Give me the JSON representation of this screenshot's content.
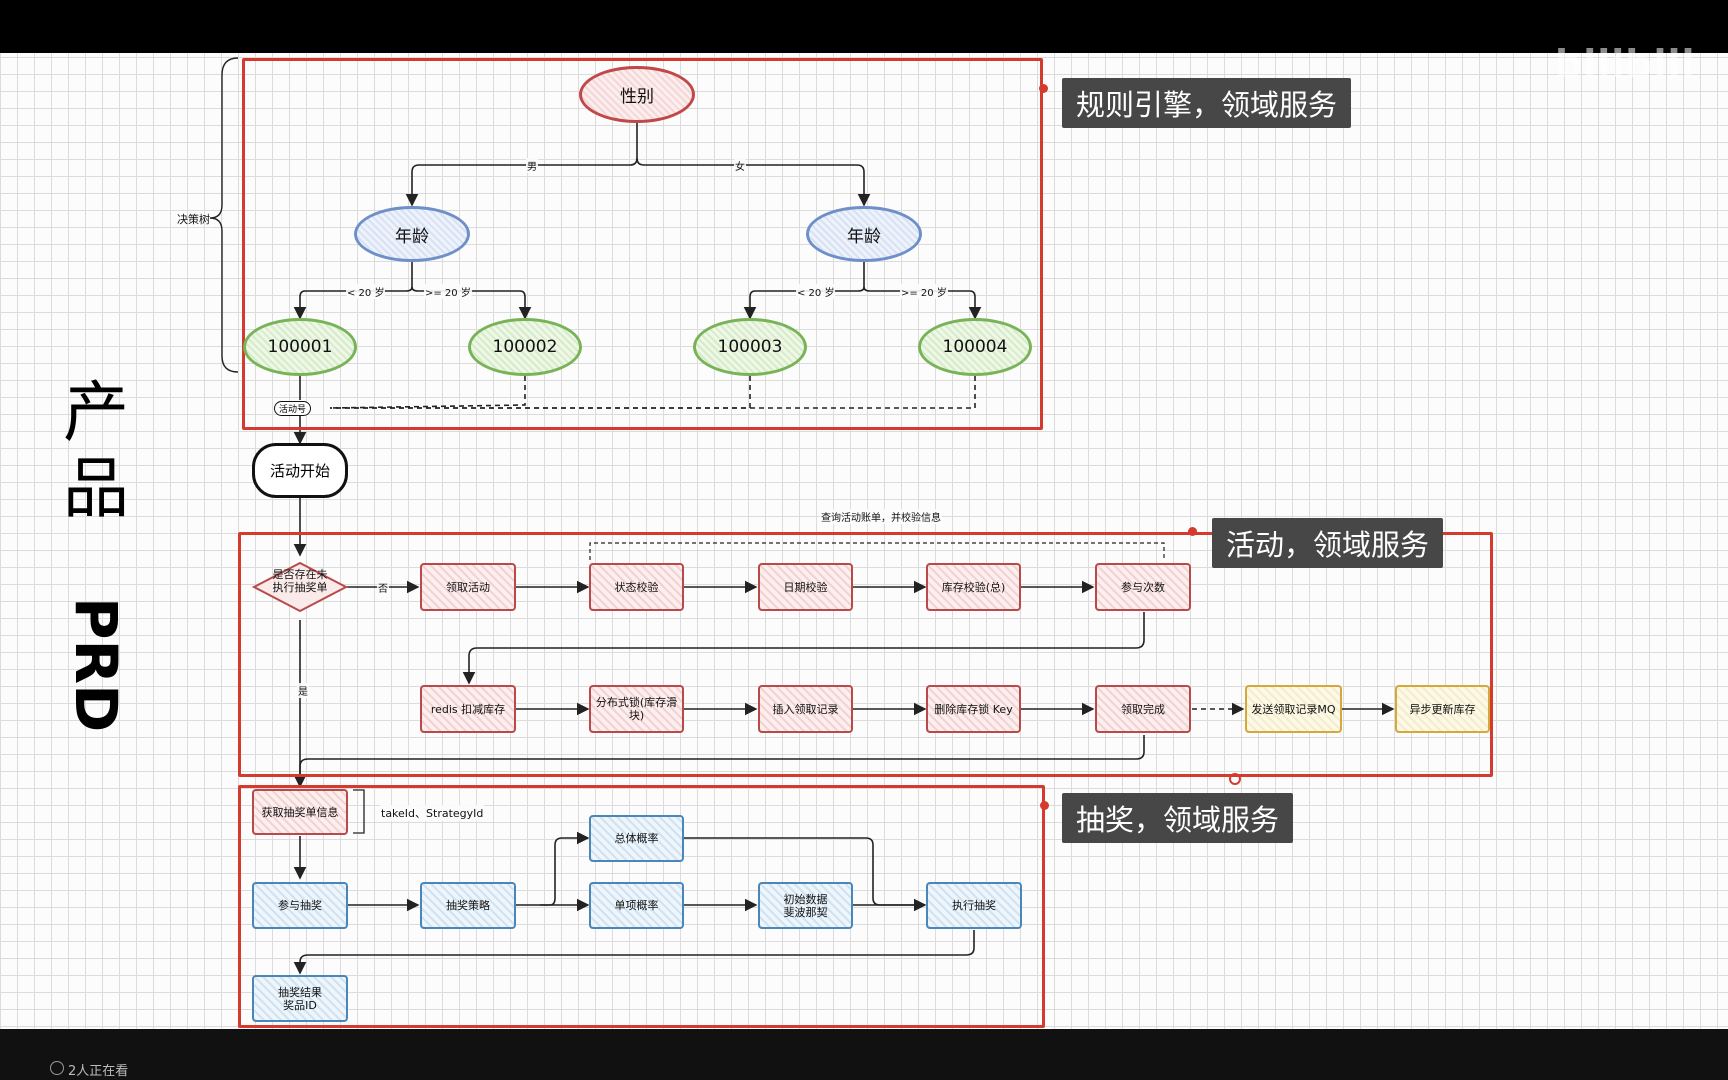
{
  "watermark": "bilibili",
  "viewer_text": "2人正在看",
  "side_title": {
    "chars": [
      "产",
      "品"
    ],
    "prd": "PRD"
  },
  "decision_tree_label": "决策树",
  "sections": {
    "rule_engine": "规则引擎，领域服务",
    "activity": "活动，领域服务",
    "lottery": "抽奖，领域服务"
  },
  "tree": {
    "root": "性别",
    "branch_male": "男",
    "branch_female": "女",
    "age_left": "年龄",
    "age_right": "年龄",
    "lt20_left": "< 20 岁",
    "ge20_left": ">= 20 岁",
    "lt20_right": "< 20 岁",
    "ge20_right": ">= 20 岁",
    "leaves": [
      "100001",
      "100002",
      "100003",
      "100004"
    ],
    "activity_no": "活动号"
  },
  "activity_flow": {
    "start": "活动开始",
    "decision": "是否存在未执行抽奖单",
    "no": "否",
    "yes": "是",
    "query_label": "查询活动账单，并校验信息",
    "row1": [
      "领取活动",
      "状态校验",
      "日期校验",
      "库存校验(总)",
      "参与次数"
    ],
    "row2": [
      "redis 扣减库存",
      "分布式锁(库存滑块)",
      "插入领取记录",
      "删除库存锁 Key",
      "领取完成"
    ],
    "mq": "发送领取记录MQ",
    "async": "异步更新库存"
  },
  "lottery_flow": {
    "get_order": "获取抽奖单信息",
    "ids_label": "takeId、StrategyId",
    "join": "参与抽奖",
    "strategy": "抽奖策略",
    "total_prob": "总体概率",
    "single_prob": "单项概率",
    "init_data": "初始数据 斐波那契",
    "execute": "执行抽奖",
    "result": "抽奖结果 奖品ID"
  },
  "colors": {
    "frame_red": "#d53a2f",
    "tag_bg": "#474747",
    "red_node": "#b84a4a",
    "blue_node": "#4a86b8",
    "green_node": "#79b358",
    "yellow_node": "#d4a93a"
  }
}
